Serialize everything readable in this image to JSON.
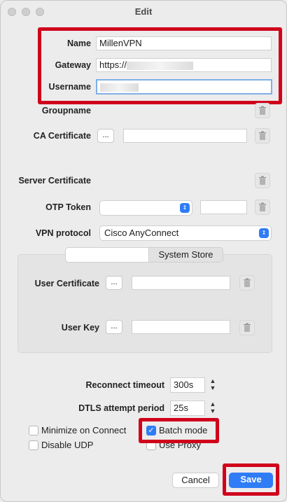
{
  "window": {
    "title": "Edit"
  },
  "fields": {
    "name_label": "Name",
    "name_value": "MillenVPN",
    "gateway_label": "Gateway",
    "gateway_value": "https://",
    "username_label": "Username",
    "groupname_label": "Groupname",
    "ca_cert_label": "CA Certificate",
    "server_cert_label": "Server Certificate",
    "otp_label": "OTP Token",
    "vpn_protocol_label": "VPN protocol",
    "vpn_protocol_value": "Cisco AnyConnect",
    "system_store_tab": "System Store",
    "user_cert_label": "User Certificate",
    "user_key_label": "User Key",
    "browse_label": "..."
  },
  "timing": {
    "reconnect_label": "Reconnect timeout",
    "reconnect_value": "300s",
    "dtls_label": "DTLS attempt period",
    "dtls_value": "25s"
  },
  "options": {
    "minimize_label": "Minimize on Connect",
    "batch_label": "Batch mode",
    "batch_checked": true,
    "disable_udp_label": "Disable UDP",
    "use_proxy_label": "Use Proxy"
  },
  "buttons": {
    "cancel": "Cancel",
    "save": "Save"
  },
  "colors": {
    "highlight": "#d0011b",
    "accent": "#2f7cf6"
  }
}
